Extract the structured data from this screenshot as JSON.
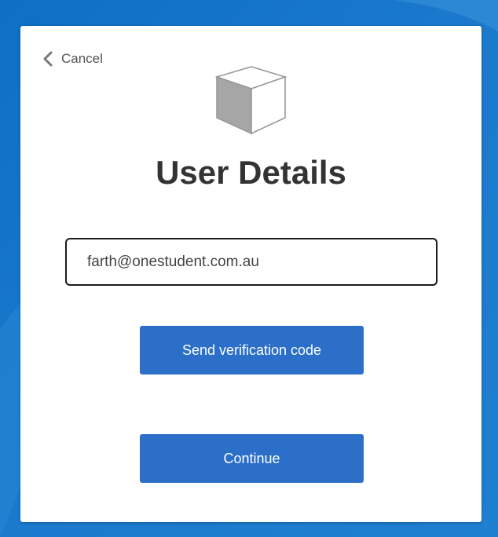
{
  "header": {
    "cancel_label": "Cancel",
    "title": "User Details"
  },
  "form": {
    "email_value": "farth@onestudent.com.au",
    "send_code_label": "Send verification code",
    "continue_label": "Continue"
  },
  "icons": {
    "back": "chevron-left-icon",
    "logo": "cube-icon"
  },
  "colors": {
    "background": "#1a79cc",
    "button": "#2b6fc8",
    "title": "#333333"
  }
}
